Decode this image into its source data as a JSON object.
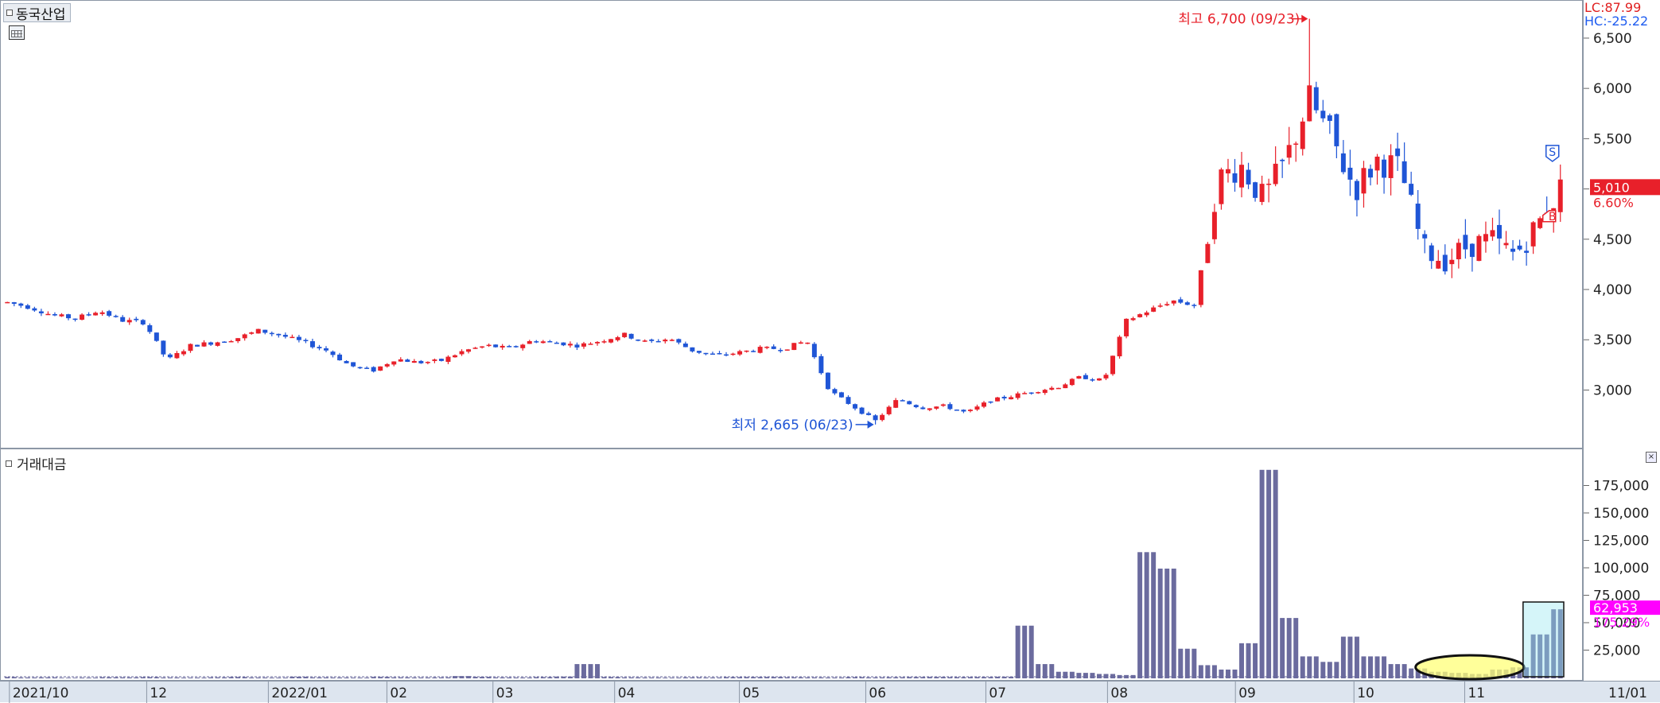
{
  "stock_name": "동국산업",
  "indicator_label": "거래대금",
  "lc_label": "LC:87.99",
  "hc_label": "HC:-25.22",
  "annotations": {
    "high": "최고 6,700 (09/23)",
    "low": "최저 2,665 (06/23)",
    "sell_marker": "S",
    "buy_marker": "B"
  },
  "price_axis": {
    "ticks": [
      "3,000",
      "3,500",
      "4,000",
      "4,500",
      "5,000",
      "5,500",
      "6,000",
      "6,500"
    ],
    "current_price": "5,010",
    "current_change": "6.60%"
  },
  "volume_axis": {
    "ticks": [
      "25,000",
      "50,000",
      "75,000",
      "100,000",
      "125,000",
      "150,000",
      "175,000"
    ],
    "current_value": "62,953",
    "current_change": "175.29%"
  },
  "x_labels": [
    "2021/10",
    "12",
    "2022/01",
    "02",
    "03",
    "04",
    "05",
    "06",
    "07",
    "08",
    "09",
    "10",
    "11",
    "11/01"
  ],
  "colors": {
    "up": "#e8202a",
    "down": "#1f55d6",
    "volume": "#6b6b9e",
    "accent_magenta": "#ff00ff"
  },
  "chart_data": [
    {
      "type": "candlestick",
      "title": "동국산업",
      "ylim": [
        2450,
        6800
      ],
      "grid": true,
      "x": [
        "2021/10",
        "12",
        "2022/01",
        "02",
        "03",
        "04",
        "05",
        "06",
        "07",
        "08",
        "09",
        "10",
        "11"
      ],
      "close": [
        3880,
        3830,
        3750,
        3720,
        3800,
        3700,
        3680,
        3300,
        3450,
        3480,
        3520,
        3600,
        3550,
        3480,
        3400,
        3250,
        3200,
        3320,
        3280,
        3300,
        3400,
        3450,
        3420,
        3500,
        3480,
        3450,
        3500,
        3560,
        3480,
        3520,
        3400,
        3350,
        3380,
        3420,
        3420,
        3500,
        3000,
        2850,
        2700,
        2920,
        2830,
        2850,
        2780,
        2900,
        2950,
        3000,
        3040,
        3140,
        3100,
        3700,
        3800,
        3900,
        3850,
        5100,
        5250,
        4900,
        5300,
        5900,
        5500,
        5000,
        5300,
        5200,
        4400,
        4300,
        4450,
        4500,
        4350,
        4650,
        5010
      ],
      "annotations": {
        "high": 6700,
        "high_date": "09/23",
        "low": 2665,
        "low_date": "06/23"
      },
      "last": {
        "price": 5010,
        "change_pct": 6.6
      }
    },
    {
      "type": "bar",
      "title": "거래대금",
      "ylim": [
        0,
        200000
      ],
      "values": [
        1200,
        800,
        900,
        600,
        700,
        1000,
        900,
        1100,
        800,
        700,
        900,
        1200,
        800,
        700,
        1500,
        900,
        800,
        700,
        1300,
        900,
        800,
        900,
        2100,
        1400,
        900,
        800,
        1100,
        1600,
        13000,
        1200,
        900,
        800,
        700,
        900,
        800,
        1100,
        1200,
        1300,
        1000,
        900,
        800,
        1100,
        900,
        1000,
        1200,
        1300,
        1100,
        1200,
        1500,
        48000,
        13000,
        6000,
        5000,
        4000,
        3000,
        115000,
        100000,
        27000,
        12000,
        8000,
        32000,
        190000,
        55000,
        20000,
        15000,
        38000,
        20000,
        13000,
        9000,
        6000,
        5000,
        4000,
        8000,
        10000,
        40000,
        62953
      ],
      "highlight": {
        "ellipse_region": "10",
        "box_region": "11"
      },
      "last": {
        "value": 62953,
        "change_pct": 175.29
      }
    }
  ]
}
